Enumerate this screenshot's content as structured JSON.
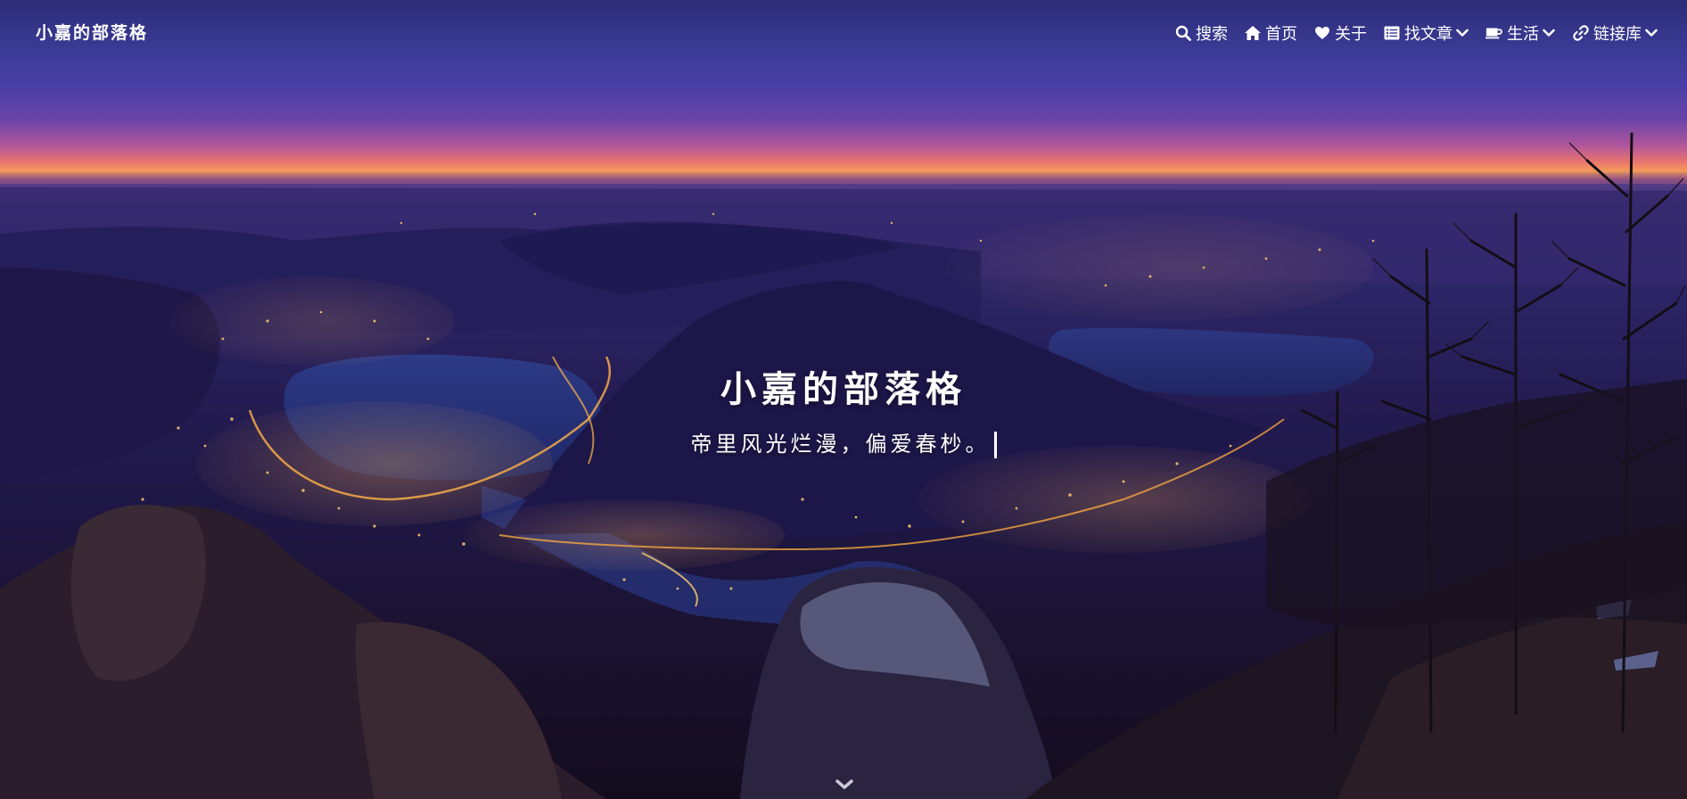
{
  "site": {
    "brand": "小嘉的部落格",
    "title": "小嘉的部落格",
    "subtitle": "帝里风光烂漫，偏爱春杪。"
  },
  "nav": {
    "items": [
      {
        "label": "搜索",
        "icon": "search-icon",
        "dropdown": false
      },
      {
        "label": "首页",
        "icon": "home-icon",
        "dropdown": false
      },
      {
        "label": "关于",
        "icon": "heart-icon",
        "dropdown": false
      },
      {
        "label": "找文章",
        "icon": "list-icon",
        "dropdown": true
      },
      {
        "label": "生活",
        "icon": "coffee-icon",
        "dropdown": true
      },
      {
        "label": "链接库",
        "icon": "link-icon",
        "dropdown": true
      }
    ]
  },
  "hero": {
    "scroll_icon": "chevron-down-icon",
    "background": "night-city-lake-mountain-photo"
  },
  "colors": {
    "text": "#ffffff",
    "sky_top": "#2c2c78",
    "horizon_glow": "#f59a5a",
    "city_lights": "#ffb347"
  }
}
